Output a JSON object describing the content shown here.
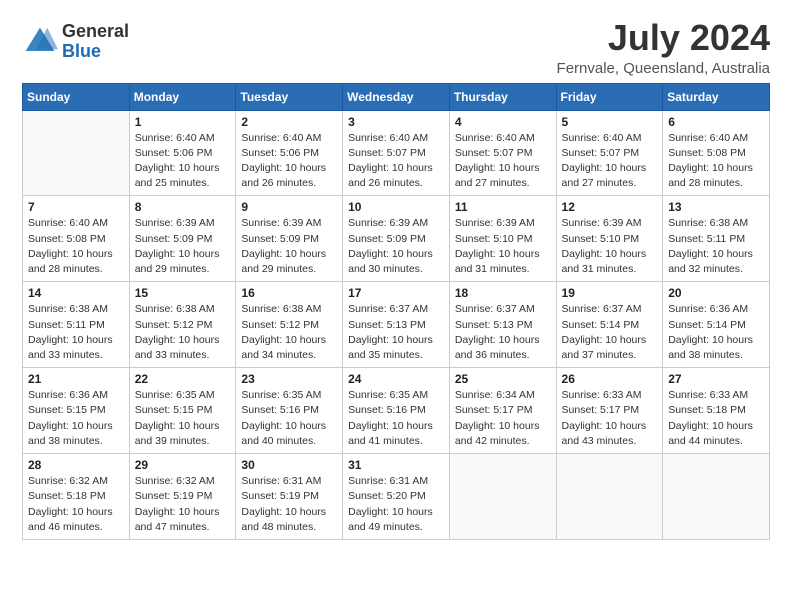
{
  "logo": {
    "general": "General",
    "blue": "Blue"
  },
  "header": {
    "month_year": "July 2024",
    "location": "Fernvale, Queensland, Australia"
  },
  "days_of_week": [
    "Sunday",
    "Monday",
    "Tuesday",
    "Wednesday",
    "Thursday",
    "Friday",
    "Saturday"
  ],
  "weeks": [
    [
      {
        "day": "",
        "sunrise": "",
        "sunset": "",
        "daylight": ""
      },
      {
        "day": "1",
        "sunrise": "Sunrise: 6:40 AM",
        "sunset": "Sunset: 5:06 PM",
        "daylight": "Daylight: 10 hours and 25 minutes."
      },
      {
        "day": "2",
        "sunrise": "Sunrise: 6:40 AM",
        "sunset": "Sunset: 5:06 PM",
        "daylight": "Daylight: 10 hours and 26 minutes."
      },
      {
        "day": "3",
        "sunrise": "Sunrise: 6:40 AM",
        "sunset": "Sunset: 5:07 PM",
        "daylight": "Daylight: 10 hours and 26 minutes."
      },
      {
        "day": "4",
        "sunrise": "Sunrise: 6:40 AM",
        "sunset": "Sunset: 5:07 PM",
        "daylight": "Daylight: 10 hours and 27 minutes."
      },
      {
        "day": "5",
        "sunrise": "Sunrise: 6:40 AM",
        "sunset": "Sunset: 5:07 PM",
        "daylight": "Daylight: 10 hours and 27 minutes."
      },
      {
        "day": "6",
        "sunrise": "Sunrise: 6:40 AM",
        "sunset": "Sunset: 5:08 PM",
        "daylight": "Daylight: 10 hours and 28 minutes."
      }
    ],
    [
      {
        "day": "7",
        "sunrise": "Sunrise: 6:40 AM",
        "sunset": "Sunset: 5:08 PM",
        "daylight": "Daylight: 10 hours and 28 minutes."
      },
      {
        "day": "8",
        "sunrise": "Sunrise: 6:39 AM",
        "sunset": "Sunset: 5:09 PM",
        "daylight": "Daylight: 10 hours and 29 minutes."
      },
      {
        "day": "9",
        "sunrise": "Sunrise: 6:39 AM",
        "sunset": "Sunset: 5:09 PM",
        "daylight": "Daylight: 10 hours and 29 minutes."
      },
      {
        "day": "10",
        "sunrise": "Sunrise: 6:39 AM",
        "sunset": "Sunset: 5:09 PM",
        "daylight": "Daylight: 10 hours and 30 minutes."
      },
      {
        "day": "11",
        "sunrise": "Sunrise: 6:39 AM",
        "sunset": "Sunset: 5:10 PM",
        "daylight": "Daylight: 10 hours and 31 minutes."
      },
      {
        "day": "12",
        "sunrise": "Sunrise: 6:39 AM",
        "sunset": "Sunset: 5:10 PM",
        "daylight": "Daylight: 10 hours and 31 minutes."
      },
      {
        "day": "13",
        "sunrise": "Sunrise: 6:38 AM",
        "sunset": "Sunset: 5:11 PM",
        "daylight": "Daylight: 10 hours and 32 minutes."
      }
    ],
    [
      {
        "day": "14",
        "sunrise": "Sunrise: 6:38 AM",
        "sunset": "Sunset: 5:11 PM",
        "daylight": "Daylight: 10 hours and 33 minutes."
      },
      {
        "day": "15",
        "sunrise": "Sunrise: 6:38 AM",
        "sunset": "Sunset: 5:12 PM",
        "daylight": "Daylight: 10 hours and 33 minutes."
      },
      {
        "day": "16",
        "sunrise": "Sunrise: 6:38 AM",
        "sunset": "Sunset: 5:12 PM",
        "daylight": "Daylight: 10 hours and 34 minutes."
      },
      {
        "day": "17",
        "sunrise": "Sunrise: 6:37 AM",
        "sunset": "Sunset: 5:13 PM",
        "daylight": "Daylight: 10 hours and 35 minutes."
      },
      {
        "day": "18",
        "sunrise": "Sunrise: 6:37 AM",
        "sunset": "Sunset: 5:13 PM",
        "daylight": "Daylight: 10 hours and 36 minutes."
      },
      {
        "day": "19",
        "sunrise": "Sunrise: 6:37 AM",
        "sunset": "Sunset: 5:14 PM",
        "daylight": "Daylight: 10 hours and 37 minutes."
      },
      {
        "day": "20",
        "sunrise": "Sunrise: 6:36 AM",
        "sunset": "Sunset: 5:14 PM",
        "daylight": "Daylight: 10 hours and 38 minutes."
      }
    ],
    [
      {
        "day": "21",
        "sunrise": "Sunrise: 6:36 AM",
        "sunset": "Sunset: 5:15 PM",
        "daylight": "Daylight: 10 hours and 38 minutes."
      },
      {
        "day": "22",
        "sunrise": "Sunrise: 6:35 AM",
        "sunset": "Sunset: 5:15 PM",
        "daylight": "Daylight: 10 hours and 39 minutes."
      },
      {
        "day": "23",
        "sunrise": "Sunrise: 6:35 AM",
        "sunset": "Sunset: 5:16 PM",
        "daylight": "Daylight: 10 hours and 40 minutes."
      },
      {
        "day": "24",
        "sunrise": "Sunrise: 6:35 AM",
        "sunset": "Sunset: 5:16 PM",
        "daylight": "Daylight: 10 hours and 41 minutes."
      },
      {
        "day": "25",
        "sunrise": "Sunrise: 6:34 AM",
        "sunset": "Sunset: 5:17 PM",
        "daylight": "Daylight: 10 hours and 42 minutes."
      },
      {
        "day": "26",
        "sunrise": "Sunrise: 6:33 AM",
        "sunset": "Sunset: 5:17 PM",
        "daylight": "Daylight: 10 hours and 43 minutes."
      },
      {
        "day": "27",
        "sunrise": "Sunrise: 6:33 AM",
        "sunset": "Sunset: 5:18 PM",
        "daylight": "Daylight: 10 hours and 44 minutes."
      }
    ],
    [
      {
        "day": "28",
        "sunrise": "Sunrise: 6:32 AM",
        "sunset": "Sunset: 5:18 PM",
        "daylight": "Daylight: 10 hours and 46 minutes."
      },
      {
        "day": "29",
        "sunrise": "Sunrise: 6:32 AM",
        "sunset": "Sunset: 5:19 PM",
        "daylight": "Daylight: 10 hours and 47 minutes."
      },
      {
        "day": "30",
        "sunrise": "Sunrise: 6:31 AM",
        "sunset": "Sunset: 5:19 PM",
        "daylight": "Daylight: 10 hours and 48 minutes."
      },
      {
        "day": "31",
        "sunrise": "Sunrise: 6:31 AM",
        "sunset": "Sunset: 5:20 PM",
        "daylight": "Daylight: 10 hours and 49 minutes."
      },
      {
        "day": "",
        "sunrise": "",
        "sunset": "",
        "daylight": ""
      },
      {
        "day": "",
        "sunrise": "",
        "sunset": "",
        "daylight": ""
      },
      {
        "day": "",
        "sunrise": "",
        "sunset": "",
        "daylight": ""
      }
    ]
  ]
}
